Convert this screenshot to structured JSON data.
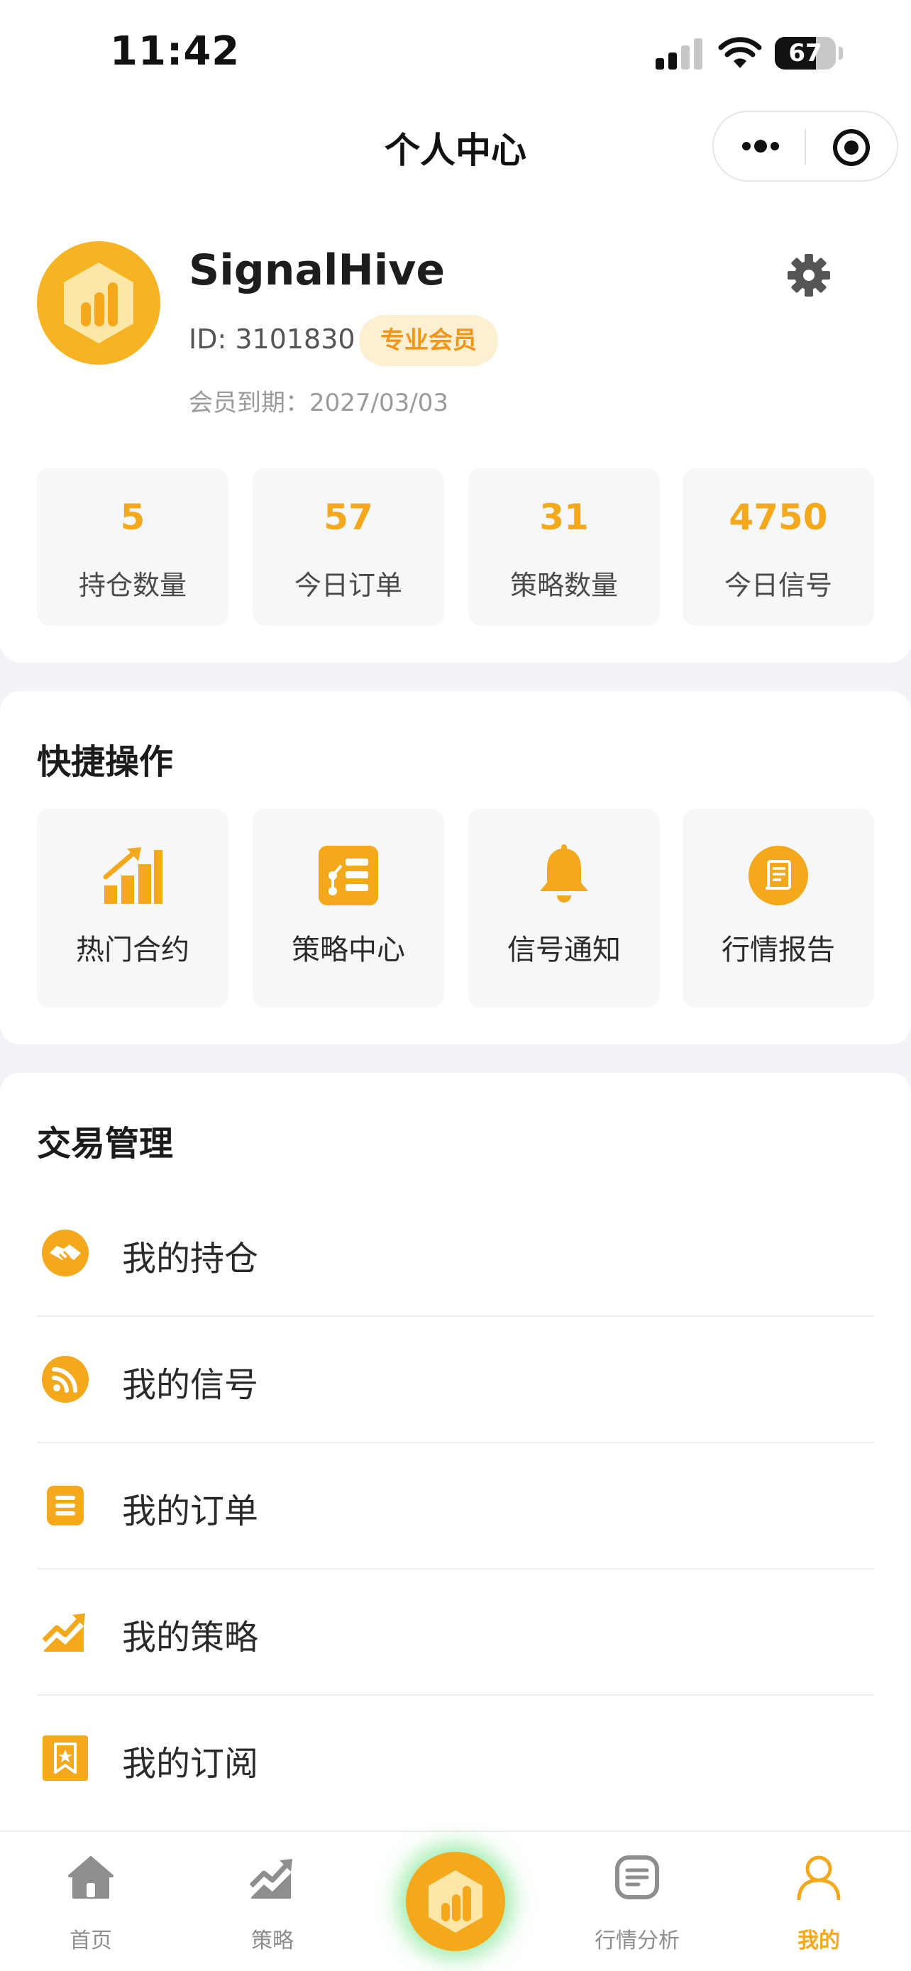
{
  "status_bar": {
    "time": "11:42",
    "battery": "67",
    "battery_level": 0.67
  },
  "header": {
    "title": "个人中心"
  },
  "profile": {
    "name": "SignalHive",
    "id_text": "ID: 3101830",
    "badge": "专业会员",
    "expire_text": "会员到期：2027/03/03"
  },
  "stats": [
    {
      "value": "5",
      "label": "持仓数量"
    },
    {
      "value": "57",
      "label": "今日订单"
    },
    {
      "value": "31",
      "label": "策略数量"
    },
    {
      "value": "4750",
      "label": "今日信号"
    }
  ],
  "quick": {
    "title": "快捷操作",
    "items": [
      {
        "label": "热门合约",
        "icon": "rising-bars-icon"
      },
      {
        "label": "策略中心",
        "icon": "strategy-icon"
      },
      {
        "label": "信号通知",
        "icon": "bell-icon"
      },
      {
        "label": "行情报告",
        "icon": "report-icon"
      }
    ]
  },
  "trade": {
    "title": "交易管理",
    "items": [
      {
        "label": "我的持仓",
        "icon": "handshake-icon"
      },
      {
        "label": "我的信号",
        "icon": "rss-icon"
      },
      {
        "label": "我的订单",
        "icon": "list-icon"
      },
      {
        "label": "我的策略",
        "icon": "trend-icon"
      },
      {
        "label": "我的订阅",
        "icon": "bookmark-star-icon"
      }
    ]
  },
  "tabbar": {
    "items": [
      {
        "label": "首页",
        "icon": "home-icon"
      },
      {
        "label": "策略",
        "icon": "chart-icon"
      },
      {
        "label": "行情分析",
        "icon": "document-icon"
      },
      {
        "label": "我的",
        "icon": "user-icon"
      }
    ],
    "active": "我的"
  },
  "colors": {
    "accent": "#f3a91b",
    "badge_bg": "#fdf0d2",
    "badge_text": "#f0961a",
    "glow": "#5adc6e"
  }
}
